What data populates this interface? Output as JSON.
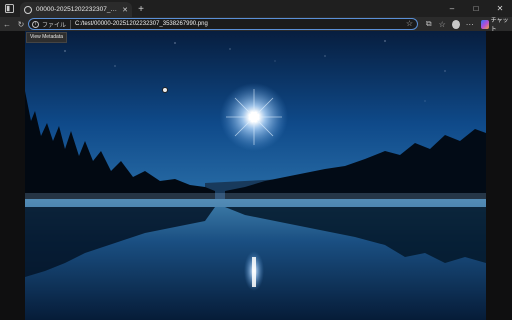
{
  "window": {
    "tab_title": "00000-2025120223230​7_3538267...",
    "controls": {
      "minimize": "–",
      "maximize": "□",
      "close": "✕"
    }
  },
  "toolbar": {
    "scheme_label": "ファイル",
    "url": "C:/test/00000-20251202232307_3538267990.png",
    "chat_label": "チャット"
  },
  "tooltip": "View Metadata",
  "icons": [
    "window-menu-icon",
    "tab-favicon-icon",
    "tab-close-icon",
    "new-tab-icon",
    "back-icon",
    "refresh-icon",
    "info-icon",
    "star-icon",
    "extensions-icon",
    "collections-icon",
    "profile-avatar",
    "more-icon",
    "copilot-icon"
  ],
  "photo": {
    "subject": "moon over lake at night"
  },
  "colors": {
    "accent": "#5a8fd6",
    "frame": "#2b2b2b"
  }
}
